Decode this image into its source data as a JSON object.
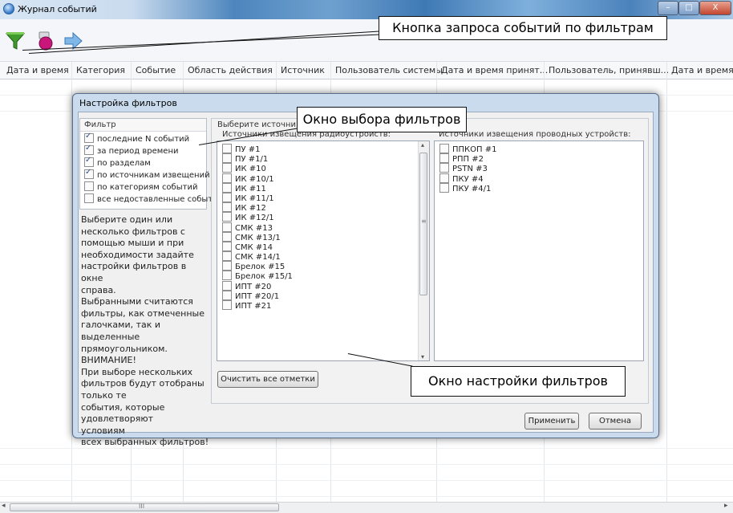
{
  "window": {
    "title": "Журнал событий",
    "controls": {
      "minimize": "–",
      "maximize": "□",
      "close": "X"
    }
  },
  "annotations": {
    "query_button": "Кнопка запроса событий по фильтрам",
    "filter_select": "Окно выбора фильтров",
    "filter_settings": "Окно настройки фильтров"
  },
  "table": {
    "columns": [
      "Дата и время",
      "Категория",
      "Событие",
      "Область действия",
      "Источник",
      "Пользователь системы",
      "Дата и время принят...",
      "Пользователь, принявш...",
      "Дата и время"
    ]
  },
  "dialog": {
    "title": "Настройка фильтров",
    "filter_header": "Фильтр",
    "filters": [
      {
        "label": "последние N событий",
        "checked": true
      },
      {
        "label": "за период времени",
        "checked": true
      },
      {
        "label": "по разделам",
        "checked": true
      },
      {
        "label": "по источникам извещений",
        "checked": true
      },
      {
        "label": "по категориям событий",
        "checked": false
      },
      {
        "label": "все недоставленные события",
        "checked": false
      }
    ],
    "hint_lines": [
      "Выберите один или",
      "несколько фильтров с",
      "помощью мыши и при",
      "необходимости задайте",
      "настройки фильтров в окне",
      "справа.",
      "Выбранными считаются",
      "фильтры, как отмеченные",
      "галочками, так и",
      "выделенные",
      "прямоугольником.",
      "ВНИМАНИЕ!",
      "При выборе нескольких",
      "фильтров будут отобраны",
      "только те",
      "события, которые",
      "удовлетворяют",
      "условиям",
      "всех выбранных фильтров!"
    ],
    "select_sources_label": "Выберите источни",
    "radio_header": "Источники извещения радиоустройств:",
    "wired_header": "Источники извещения проводных устройств:",
    "radio_sources": [
      "ПУ #1",
      "ПУ #1/1",
      "ИК #10",
      "ИК #10/1",
      "ИК #11",
      "ИК #11/1",
      "ИК #12",
      "ИК #12/1",
      "СМК #13",
      "СМК #13/1",
      "СМК #14",
      "СМК #14/1",
      "Брелок #15",
      "Брелок #15/1",
      "ИПТ #20",
      "ИПТ #20/1",
      "ИПТ #21"
    ],
    "wired_sources": [
      "ППКОП #1",
      "РПП #2",
      "PSTN #3",
      "ПКУ #4",
      "ПКУ #4/1"
    ],
    "clear_button": "Очистить все отметки",
    "apply_button": "Применить",
    "cancel_button": "Отмена",
    "scroll_marker": "≡"
  },
  "scrollbar": {
    "grip": "III"
  },
  "colors": {
    "accent": "#4d86bd",
    "dialog_frame": "#c9dbed"
  }
}
